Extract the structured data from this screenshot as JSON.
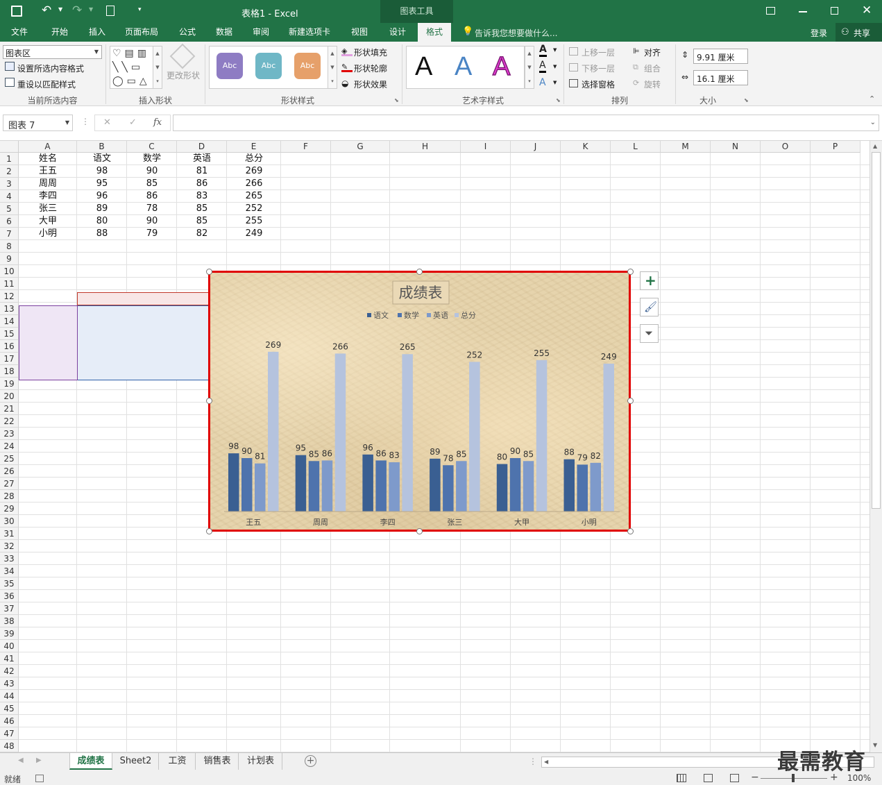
{
  "window": {
    "title": "表格1 - Excel",
    "context_tools": "图表工具",
    "login": "登录",
    "share": "共享"
  },
  "tabs": [
    "文件",
    "开始",
    "插入",
    "页面布局",
    "公式",
    "数据",
    "审阅",
    "新建选项卡",
    "视图",
    "设计",
    "格式"
  ],
  "tell_me": "告诉我您想要做什么...",
  "ribbon": {
    "current": {
      "selector": "图表区",
      "format_sel": "设置所选内容格式",
      "reset": "重设以匹配样式",
      "label": "当前所选内容"
    },
    "insert_shapes": {
      "change_shape": "更改形状",
      "label": "插入形状"
    },
    "shape_styles": {
      "sample": "Abc",
      "fill": "形状填充",
      "outline": "形状轮廓",
      "effect": "形状效果",
      "label": "形状样式"
    },
    "wordart": {
      "glyph": "A",
      "label": "艺术字样式"
    },
    "arrange": {
      "bring_forward": "上移一层",
      "send_backward": "下移一层",
      "selection_pane": "选择窗格",
      "align": "对齐",
      "group": "组合",
      "rotate": "旋转",
      "label": "排列"
    },
    "size": {
      "height": "9.91 厘米",
      "width": "16.1 厘米",
      "label": "大小"
    }
  },
  "formula_bar": {
    "name_box": "图表 7",
    "fx": "fx",
    "content": ""
  },
  "columns": [
    "A",
    "B",
    "C",
    "D",
    "E",
    "F",
    "G",
    "H",
    "I",
    "J",
    "K",
    "L",
    "M",
    "N",
    "O",
    "P"
  ],
  "rows": [
    "1",
    "2",
    "3",
    "4",
    "5",
    "6",
    "7",
    "8",
    "9",
    "10",
    "11",
    "12",
    "13",
    "14",
    "15",
    "16",
    "17",
    "18",
    "19",
    "20",
    "21",
    "22",
    "23",
    "24",
    "25",
    "26",
    "27",
    "28",
    "29",
    "30",
    "31",
    "32",
    "33",
    "34",
    "35",
    "36",
    "37",
    "38",
    "39",
    "40",
    "41",
    "42",
    "43",
    "44",
    "45",
    "46",
    "47",
    "48"
  ],
  "table": {
    "headers": [
      "姓名",
      "语文",
      "数学",
      "英语",
      "总分"
    ],
    "rows": [
      [
        "王五",
        "98",
        "90",
        "81",
        "269"
      ],
      [
        "周周",
        "95",
        "85",
        "86",
        "266"
      ],
      [
        "李四",
        "96",
        "86",
        "83",
        "265"
      ],
      [
        "张三",
        "89",
        "78",
        "85",
        "252"
      ],
      [
        "大甲",
        "80",
        "90",
        "85",
        "255"
      ],
      [
        "小明",
        "88",
        "79",
        "82",
        "249"
      ]
    ]
  },
  "chart_data": {
    "type": "bar",
    "title": "成绩表",
    "categories": [
      "王五",
      "周周",
      "李四",
      "张三",
      "大甲",
      "小明"
    ],
    "series": [
      {
        "name": "语文",
        "values": [
          98,
          95,
          96,
          89,
          80,
          88
        ],
        "color": "#3a5f92"
      },
      {
        "name": "数学",
        "values": [
          90,
          85,
          86,
          78,
          90,
          79
        ],
        "color": "#4e73ad"
      },
      {
        "name": "英语",
        "values": [
          81,
          86,
          83,
          85,
          85,
          82
        ],
        "color": "#7e9acb"
      },
      {
        "name": "总分",
        "values": [
          269,
          266,
          265,
          252,
          255,
          249
        ],
        "color": "#b5c3de"
      }
    ],
    "legend": "top",
    "ylim": [
      0,
      300
    ],
    "gridlines": false,
    "data_labels": true
  },
  "sheet_tabs": [
    "成绩表",
    "Sheet2",
    "工资",
    "销售表",
    "计划表"
  ],
  "status": {
    "ready": "就绪",
    "zoom": "100%"
  },
  "watermark": "最需教育",
  "colors": {
    "excel_green": "#217346",
    "chart_border": "#e00000"
  }
}
